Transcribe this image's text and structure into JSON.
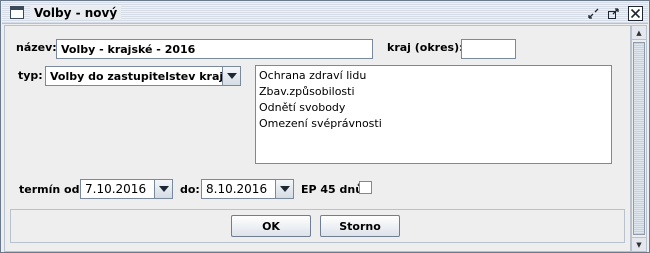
{
  "window": {
    "title": "Volby - nový"
  },
  "form": {
    "nazev_label": "název:",
    "nazev_value": "Volby - krajské - 2016",
    "kraj_label": "kraj (okres):",
    "kraj_value": "",
    "typ_label": "typ:",
    "typ_value": "Volby do zastupitelstev krajů",
    "reasons": [
      "Ochrana zdraví lidu",
      "Zbav.způsobilosti",
      "Odnětí svobody",
      "Omezení svéprávnosti"
    ],
    "termin_od_label": "termín od:",
    "termin_od_value": "7.10.2016",
    "do_label": "do:",
    "do_value": "8.10.2016",
    "ep_label": "EP 45 dnů:",
    "ep_checked": false
  },
  "buttons": {
    "ok_label": "OK",
    "storno_label": "Storno"
  }
}
